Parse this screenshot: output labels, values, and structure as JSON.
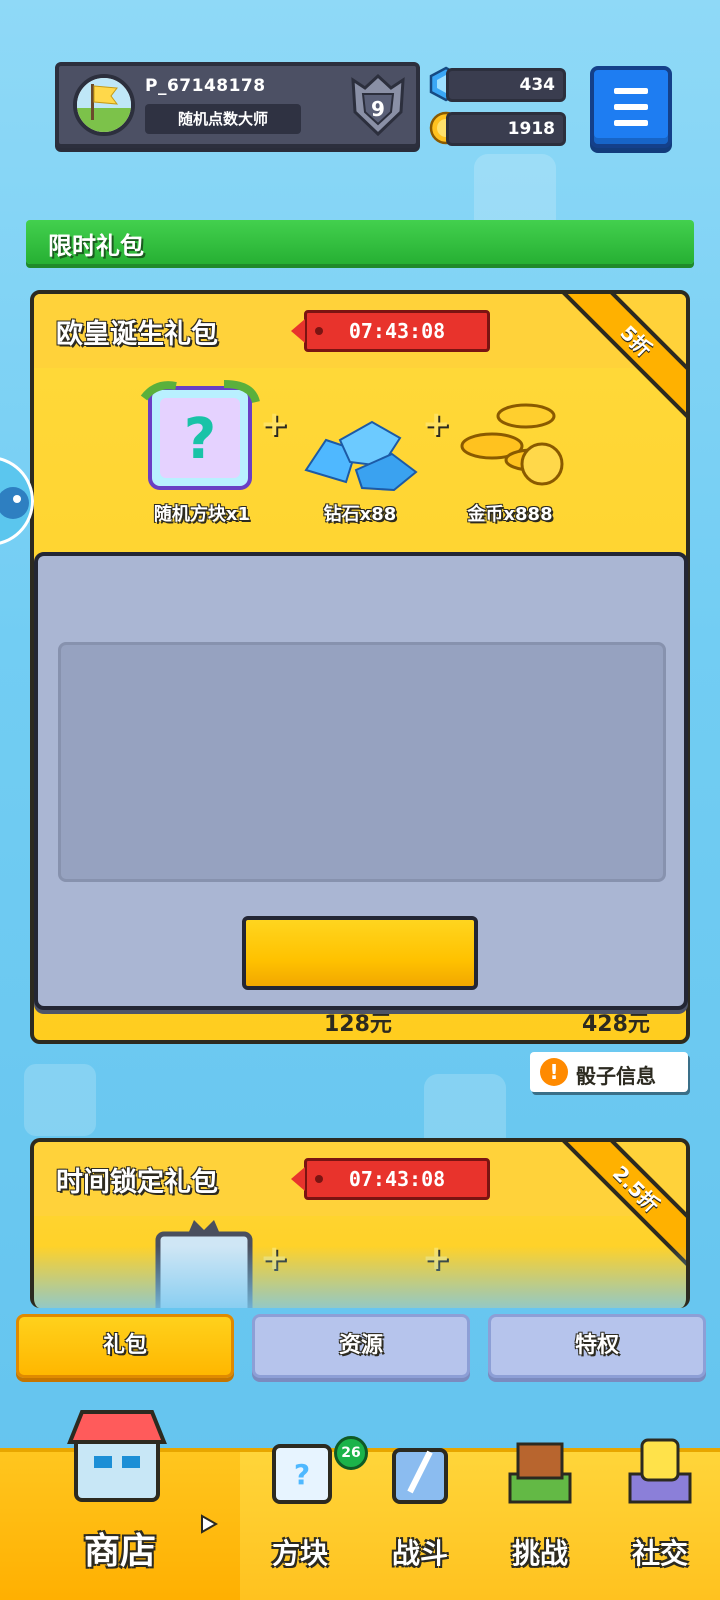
{
  "header": {
    "player_id": "P_67148178",
    "player_title": "随机点数大师",
    "rank": "9",
    "gems": "434",
    "coins": "1918"
  },
  "section": {
    "title": "限时礼包"
  },
  "packs": [
    {
      "title": "欧皇诞生礼包",
      "timer": "07:43:08",
      "discount": "5折",
      "items": [
        {
          "label": "随机方块x1",
          "icon": "mystery-block-icon"
        },
        {
          "label": "钻石x88",
          "icon": "diamond-pile-icon"
        },
        {
          "label": "金币x888",
          "icon": "gold-coins-icon"
        }
      ],
      "price": "128元",
      "original_price": "428元"
    },
    {
      "title": "时间锁定礼包",
      "timer": "07:43:08",
      "discount": "2.5折"
    }
  ],
  "dice_info": {
    "label": "骰子信息"
  },
  "tabs": [
    {
      "label": "礼包",
      "active": true
    },
    {
      "label": "资源",
      "active": false
    },
    {
      "label": "特权",
      "active": false
    }
  ],
  "bottom_nav": {
    "shop": "商店",
    "blocks": "方块",
    "blocks_badge": "26",
    "battle": "战斗",
    "challenge": "挑战",
    "social": "社交"
  },
  "colors": {
    "accent_yellow": "#ffcd1f",
    "green_bar": "#26b033",
    "timer_red": "#e8332c",
    "menu_blue": "#1e7df2"
  }
}
